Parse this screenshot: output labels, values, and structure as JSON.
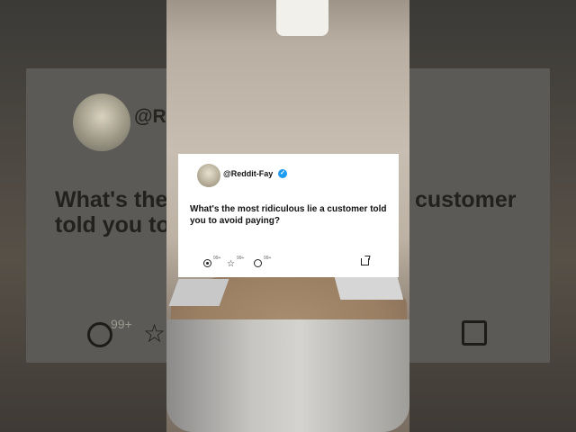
{
  "post": {
    "handle": "@Reddit-Fay",
    "question": "What's the most ridiculous lie a customer told you to avoid paying?",
    "actions": [
      {
        "name": "like",
        "icon": "heart-icon",
        "count": "99+"
      },
      {
        "name": "retweet",
        "icon": "star-icon",
        "count": "99+"
      },
      {
        "name": "comment",
        "icon": "comment-icon",
        "count": "99+"
      },
      {
        "name": "share",
        "icon": "share-icon"
      }
    ]
  },
  "background": {
    "handle_fragment": "@Re",
    "question_line1": "What's the",
    "question_line2": "told you to",
    "question_line3": "customer",
    "like_count": "99+"
  },
  "colors": {
    "verified": "#1d9bf0",
    "card": "#ffffff"
  }
}
